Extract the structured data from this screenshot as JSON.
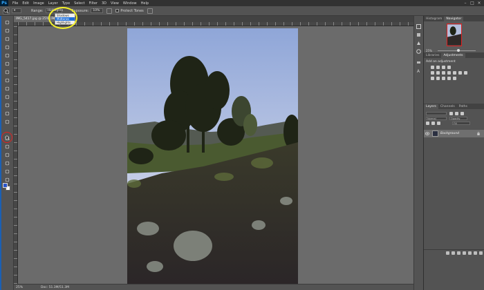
{
  "app": {
    "logo": "Ps",
    "menu": [
      "File",
      "Edit",
      "Image",
      "Layer",
      "Type",
      "Select",
      "Filter",
      "3D",
      "View",
      "Window",
      "Help"
    ],
    "window_controls": [
      "–",
      "□",
      "×"
    ]
  },
  "options_bar": {
    "range_label": "Range:",
    "range_value": "Highlights",
    "range_options": [
      "Shadows",
      "Midtones",
      "Highlights"
    ],
    "exposure_label": "Exposure:",
    "exposure_value": "10%",
    "protect_tones_label": "Protect Tones"
  },
  "document": {
    "tab_title": "IMG_5417.jpg @ 25% (RGB/8)",
    "close": "×"
  },
  "status_bar": {
    "zoom": "25%",
    "doc_size": "Doc: 51.3M/51.3M"
  },
  "panels": {
    "top_tabs": [
      "Histogram",
      "Navigator"
    ],
    "navigator_zoom": "25%",
    "mid_tabs": [
      "Libraries",
      "Adjustments"
    ],
    "adjustments_title": "Add an adjustment",
    "layer_tabs": [
      "Layers",
      "Channels",
      "Paths"
    ],
    "blend_mode": "Normal",
    "opacity": "Opacity",
    "fill": "Fill",
    "layer_name": "Background"
  },
  "colors": {
    "foreground": "#2a55c9",
    "background": "#ffffff",
    "highlight_ring": "#f4f12a",
    "tool_ring": "#e32020"
  },
  "icons": {
    "tool_highlighted": "dodge-tool-icon"
  }
}
